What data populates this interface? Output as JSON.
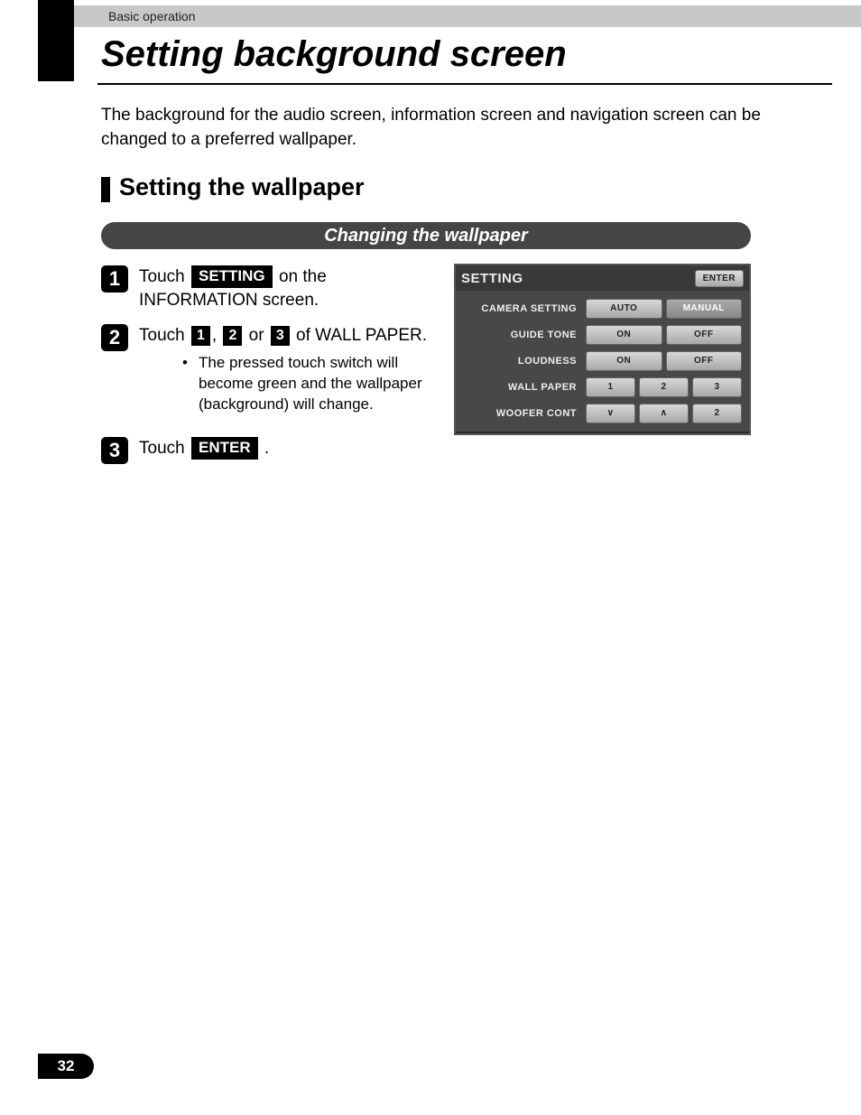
{
  "breadcrumb": "Basic operation",
  "title": "Setting background screen",
  "intro": "The background for the audio screen, information screen and navigation screen can be changed to a preferred wallpaper.",
  "section_title": "Setting the wallpaper",
  "pill": "Changing the wallpaper",
  "steps": {
    "s1": {
      "num": "1",
      "pre": "Touch ",
      "kbd": "SETTING",
      "post": " on the INFORMATION screen."
    },
    "s2": {
      "num": "2",
      "pre": "Touch ",
      "k1": "1",
      "sep1": ", ",
      "k2": "2",
      "sep2": " or ",
      "k3": "3",
      "post": " of WALL PAPER.",
      "note": "The pressed touch switch will become green and the wallpaper (background) will change."
    },
    "s3": {
      "num": "3",
      "pre": "Touch ",
      "kbd": "ENTER",
      "post": "."
    }
  },
  "device": {
    "title": "SETTING",
    "enter": "ENTER",
    "rows": [
      {
        "label": "CAMERA SETTING",
        "btns": [
          "AUTO",
          "MANUAL"
        ]
      },
      {
        "label": "GUIDE TONE",
        "btns": [
          "ON",
          "OFF"
        ]
      },
      {
        "label": "LOUDNESS",
        "btns": [
          "ON",
          "OFF"
        ]
      },
      {
        "label": "WALL PAPER",
        "btns": [
          "1",
          "2",
          "3"
        ]
      },
      {
        "label": "WOOFER CONT",
        "btns": [
          "∨",
          "∧",
          "2"
        ]
      }
    ]
  },
  "page_number": "32"
}
